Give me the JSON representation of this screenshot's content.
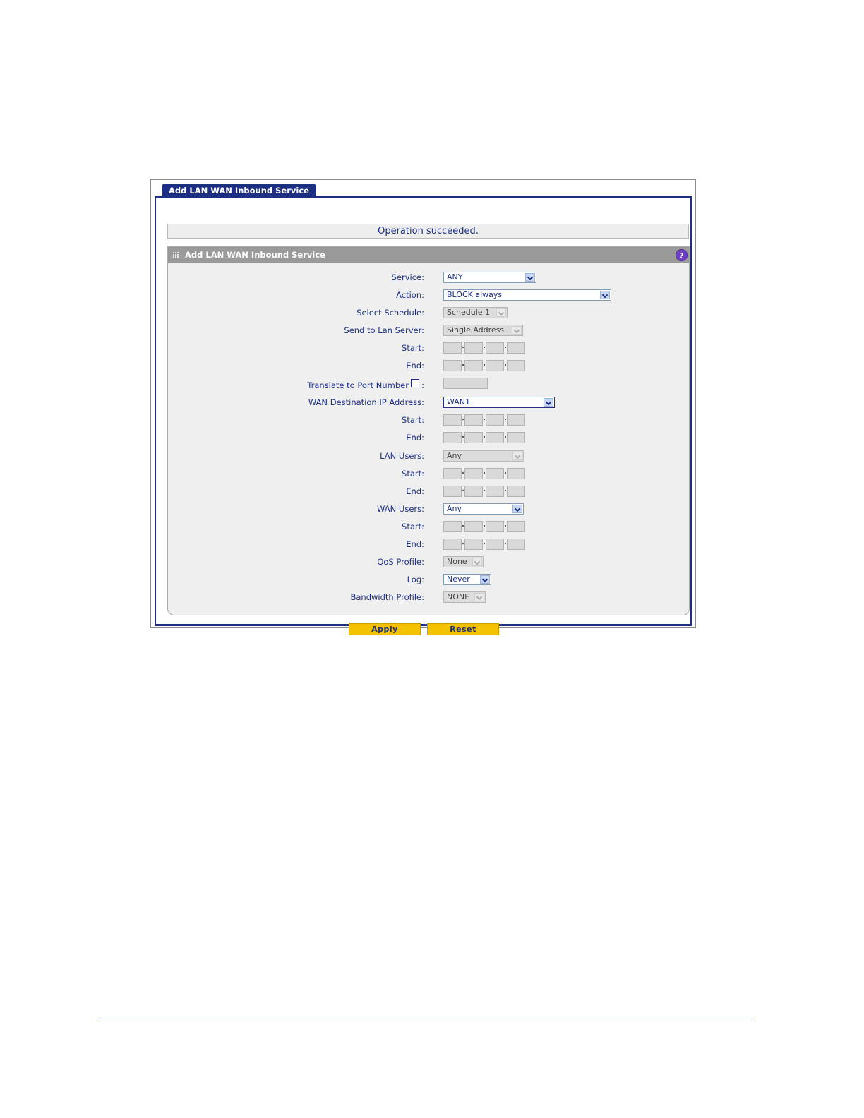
{
  "tab": {
    "label": "Add LAN WAN Inbound Service"
  },
  "status_message": "Operation succeeded.",
  "panel": {
    "title": "Add LAN WAN Inbound Service",
    "help_icon": "help-icon"
  },
  "form": {
    "service": {
      "label": "Service:",
      "value": "ANY"
    },
    "action": {
      "label": "Action:",
      "value": "BLOCK always"
    },
    "select_schedule": {
      "label": "Select Schedule:",
      "value": "Schedule 1"
    },
    "send_to_lan_server": {
      "label": "Send to Lan Server:",
      "value": "Single Address"
    },
    "lan_server_start": {
      "label": "Start:"
    },
    "lan_server_end": {
      "label": "End:"
    },
    "translate_port": {
      "label": "Translate to Port Number",
      "suffix": ":"
    },
    "wan_destination_ip": {
      "label": "WAN Destination IP Address:",
      "value": "WAN1"
    },
    "wan_dest_start": {
      "label": "Start:"
    },
    "wan_dest_end": {
      "label": "End:"
    },
    "lan_users": {
      "label": "LAN Users:",
      "value": "Any"
    },
    "lan_users_start": {
      "label": "Start:"
    },
    "lan_users_end": {
      "label": "End:"
    },
    "wan_users": {
      "label": "WAN Users:",
      "value": "Any"
    },
    "wan_users_start": {
      "label": "Start:"
    },
    "wan_users_end": {
      "label": "End:"
    },
    "qos_profile": {
      "label": "QoS Profile:",
      "value": "None"
    },
    "log": {
      "label": "Log:",
      "value": "Never"
    },
    "bandwidth_profile": {
      "label": "Bandwidth Profile:",
      "value": "NONE"
    }
  },
  "buttons": {
    "apply": "Apply",
    "reset": "Reset"
  },
  "colors": {
    "accent": "#1c2f82",
    "button": "#f2c200",
    "panel_header": "#9a9a9a",
    "help": "#6e3fc6"
  }
}
